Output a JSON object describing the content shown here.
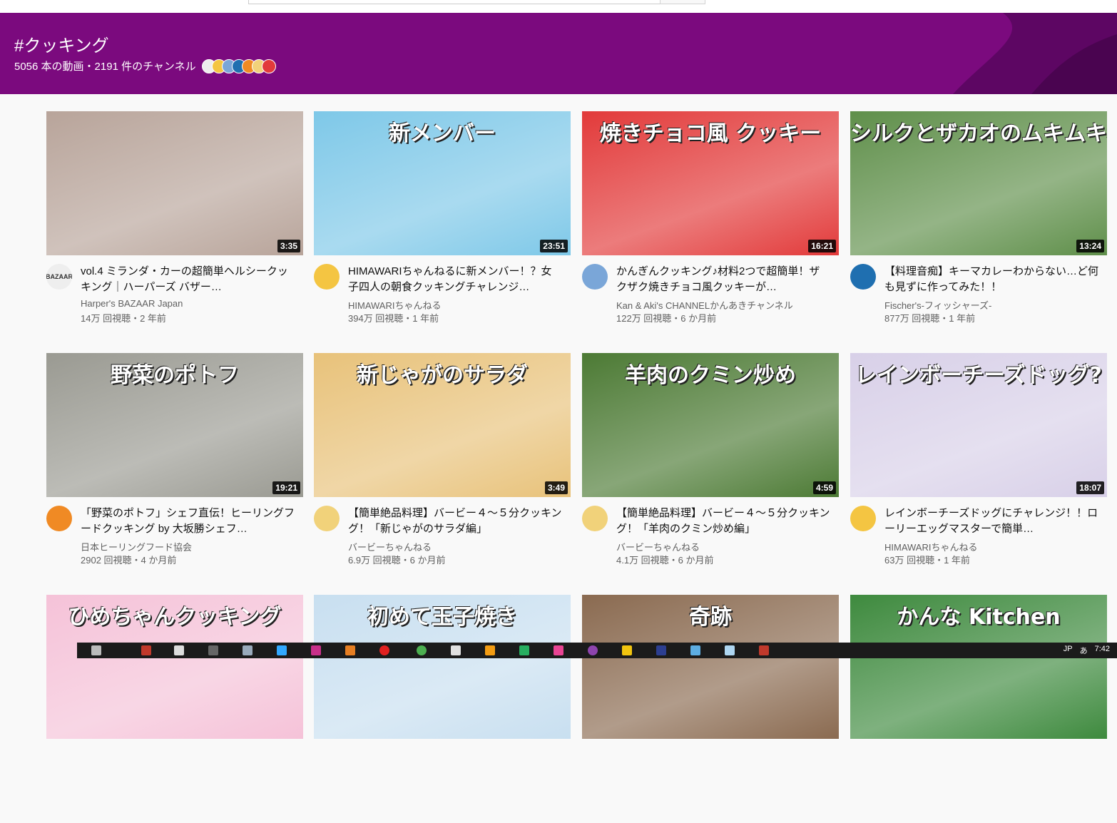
{
  "search": {
    "placeholder": ""
  },
  "hashtag_page": {
    "title": "#クッキング",
    "stats": "5056 本の動画・2191 件のチャンネル",
    "banner_color": "#7b0a7e"
  },
  "videos": [
    {
      "title": "vol.4 ミランダ・カーの超簡単ヘルシークッキング｜ハーパーズ バザー…",
      "channel": "Harper's BAZAAR Japan",
      "views": "14万 回視聴・2 年前",
      "duration": "3:35",
      "thumb_text": "",
      "avatar_text": "BAZAAR",
      "thumb_color": "#b8a49a",
      "avatar_color": "#eeeeee"
    },
    {
      "title": "HIMAWARIちゃんねるに新メンバー！？女子四人の朝食クッキングチャレンジ…",
      "channel": "HIMAWARIちゃんねる",
      "views": "394万 回視聴・1 年前",
      "duration": "23:51",
      "thumb_text": "新メンバー",
      "avatar_text": "",
      "thumb_color": "#7ec8e8",
      "avatar_color": "#f4c542"
    },
    {
      "title": "かんぎんクッキング♪材料2つで超簡単！ザクザク焼きチョコ風クッキーが…",
      "channel": "Kan & Aki's CHANNELかんあきチャンネル",
      "views": "122万 回視聴・6 か月前",
      "duration": "16:21",
      "thumb_text": "焼きチョコ風 クッキー",
      "avatar_text": "",
      "thumb_color": "#e23a3a",
      "avatar_color": "#7aa6d8"
    },
    {
      "title": "【料理音痴】キーマカレーわからない…ど何も見ずに作ってみた！！",
      "channel": "Fischer's-フィッシャーズ-",
      "views": "877万 回視聴・1 年前",
      "duration": "13:24",
      "thumb_text": "シルクとザカオのムキムキ料理音痴クッキング!",
      "avatar_text": "",
      "thumb_color": "#5f8f4a",
      "avatar_color": "#1f6fb0"
    },
    {
      "title": "「野菜のポトフ」シェフ直伝！ヒーリングフードクッキング by 大坂勝シェフ…",
      "channel": "日本ヒーリングフード協会",
      "views": "2902 回視聴・4 か月前",
      "duration": "19:21",
      "thumb_text": "野菜のポトフ",
      "avatar_text": "",
      "thumb_color": "#9a9a92",
      "avatar_color": "#f08a24"
    },
    {
      "title": "【簡単絶品料理】バービー４～５分クッキング！「新じゃがのサラダ編」",
      "channel": "バービーちゃんねる",
      "views": "6.9万 回視聴・6 か月前",
      "duration": "3:49",
      "thumb_text": "新じゃがのサラダ",
      "avatar_text": "",
      "thumb_color": "#e8c27a",
      "avatar_color": "#f1d27a"
    },
    {
      "title": "【簡単絶品料理】バービー４～５分クッキング！「羊肉のクミン炒め編」",
      "channel": "バービーちゃんねる",
      "views": "4.1万 回視聴・6 か月前",
      "duration": "4:59",
      "thumb_text": "羊肉のクミン炒め",
      "avatar_text": "",
      "thumb_color": "#4c7a34",
      "avatar_color": "#f1d27a"
    },
    {
      "title": "レインボーチーズドッグにチャレンジ！！ローリーエッグマスターで簡単…",
      "channel": "HIMAWARIちゃんねる",
      "views": "63万 回視聴・1 年前",
      "duration": "18:07",
      "thumb_text": "レインボーチーズドッグ?",
      "avatar_text": "",
      "thumb_color": "#d8d0e8",
      "avatar_color": "#f4c542"
    },
    {
      "title": "",
      "channel": "",
      "views": "",
      "duration": "",
      "thumb_text": "ひめちゃんクッキング",
      "avatar_text": "",
      "thumb_color": "#f5c2d8",
      "avatar_color": "#ffffff"
    },
    {
      "title": "",
      "channel": "",
      "views": "",
      "duration": "",
      "thumb_text": "初めて玉子焼き",
      "avatar_text": "",
      "thumb_color": "#c8dff0",
      "avatar_color": "#ffffff"
    },
    {
      "title": "",
      "channel": "",
      "views": "",
      "duration": "",
      "thumb_text": "奇跡",
      "avatar_text": "",
      "thumb_color": "#8a6a50",
      "avatar_color": "#ffffff"
    },
    {
      "title": "",
      "channel": "",
      "views": "",
      "duration": "",
      "thumb_text": "かんな Kitchen",
      "avatar_text": "",
      "thumb_color": "#3e8a3e",
      "avatar_color": "#ffffff"
    }
  ],
  "taskbar": {
    "ime": "JP",
    "ime_mode": "あ",
    "clock": "7:42"
  }
}
